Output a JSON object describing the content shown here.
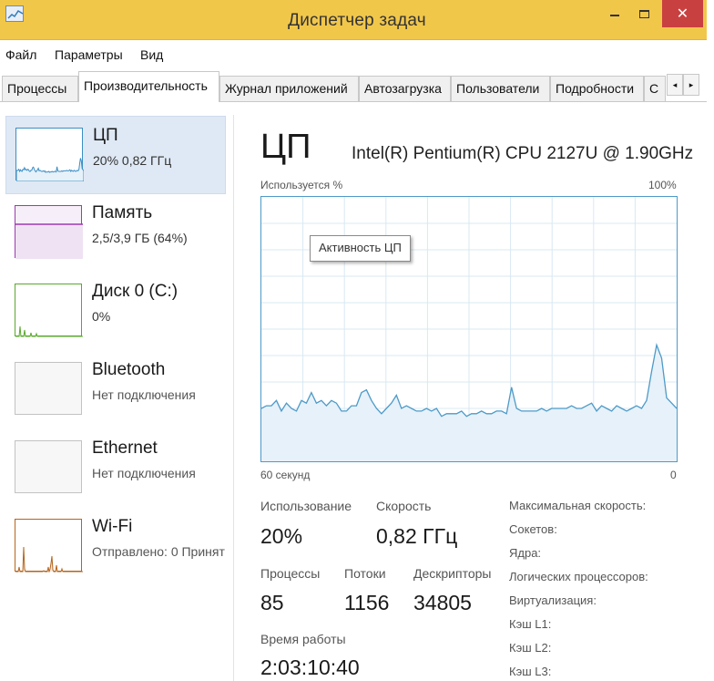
{
  "window": {
    "title": "Диспетчер задач",
    "close_glyph": "✕"
  },
  "menu": [
    "Файл",
    "Параметры",
    "Вид"
  ],
  "tabs": [
    {
      "label": "Процессы",
      "active": false
    },
    {
      "label": "Производительность",
      "active": true
    },
    {
      "label": "Журнал приложений",
      "active": false
    },
    {
      "label": "Автозагрузка",
      "active": false
    },
    {
      "label": "Пользователи",
      "active": false
    },
    {
      "label": "Подробности",
      "active": false
    },
    {
      "label": "С",
      "active": false
    }
  ],
  "tab_scroll": {
    "left": "◂",
    "right": "▸"
  },
  "left_panel": {
    "items": [
      {
        "name": "ЦП",
        "sub": "20% 0,82 ГГц",
        "color": "#3c8ec4"
      },
      {
        "name": "Память",
        "sub": "2,5/3,9 ГБ (64%)",
        "color": "#9b3bb0"
      },
      {
        "name": "Диск 0 (C:)",
        "sub": "0%",
        "color": "#5aa82e"
      },
      {
        "name": "Bluetooth",
        "sub": "Нет подключения"
      },
      {
        "name": "Ethernet",
        "sub": "Нет подключения"
      },
      {
        "name": "Wi-Fi",
        "sub": "Отправлено: 0 Принят",
        "color": "#b5651d"
      }
    ]
  },
  "cpu": {
    "title": "ЦП",
    "model": "Intel(R) Pentium(R) CPU 2127U @ 1.90GHz",
    "graph": {
      "y_label": "Используется %",
      "y_max_label": "100%",
      "x_left_label": "60 секунд",
      "x_right_label": "0",
      "tooltip": "Активность ЦП",
      "line_color": "#4d9ac8",
      "fill_color": "#e7f1f9",
      "grid_color": "#d9e8f3",
      "usage_percent": [
        20,
        21,
        21,
        23,
        19,
        22,
        20,
        19,
        23,
        22,
        26,
        22,
        23,
        21,
        23,
        22,
        19,
        19,
        21,
        21,
        26,
        27,
        23,
        20,
        18,
        20,
        22,
        25,
        20,
        21,
        20,
        19,
        19,
        20,
        19,
        20,
        17,
        18,
        18,
        18,
        19,
        17,
        18,
        18,
        19,
        18,
        18,
        19,
        19,
        18,
        28,
        20,
        19,
        19,
        19,
        19,
        20,
        19,
        20,
        20,
        20,
        20,
        21,
        20,
        20,
        21,
        22,
        19,
        21,
        20,
        19,
        21,
        20,
        19,
        20,
        21,
        20,
        23,
        34,
        44,
        39,
        24,
        22,
        20
      ]
    },
    "stats": {
      "usage_label": "Использование",
      "usage_value": "20%",
      "speed_label": "Скорость",
      "speed_value": "0,82 ГГц",
      "processes_label": "Процессы",
      "processes_value": "85",
      "threads_label": "Потоки",
      "threads_value": "1156",
      "handles_label": "Дескрипторы",
      "handles_value": "34805",
      "uptime_label": "Время работы",
      "uptime_value": "2:03:10:40"
    },
    "info": [
      "Максимальная скорость:",
      "Сокетов:",
      "Ядра:",
      "Логических процессоров:",
      "Виртуализация:",
      "Кэш L1:",
      "Кэш L2:",
      "Кэш L3:"
    ]
  }
}
